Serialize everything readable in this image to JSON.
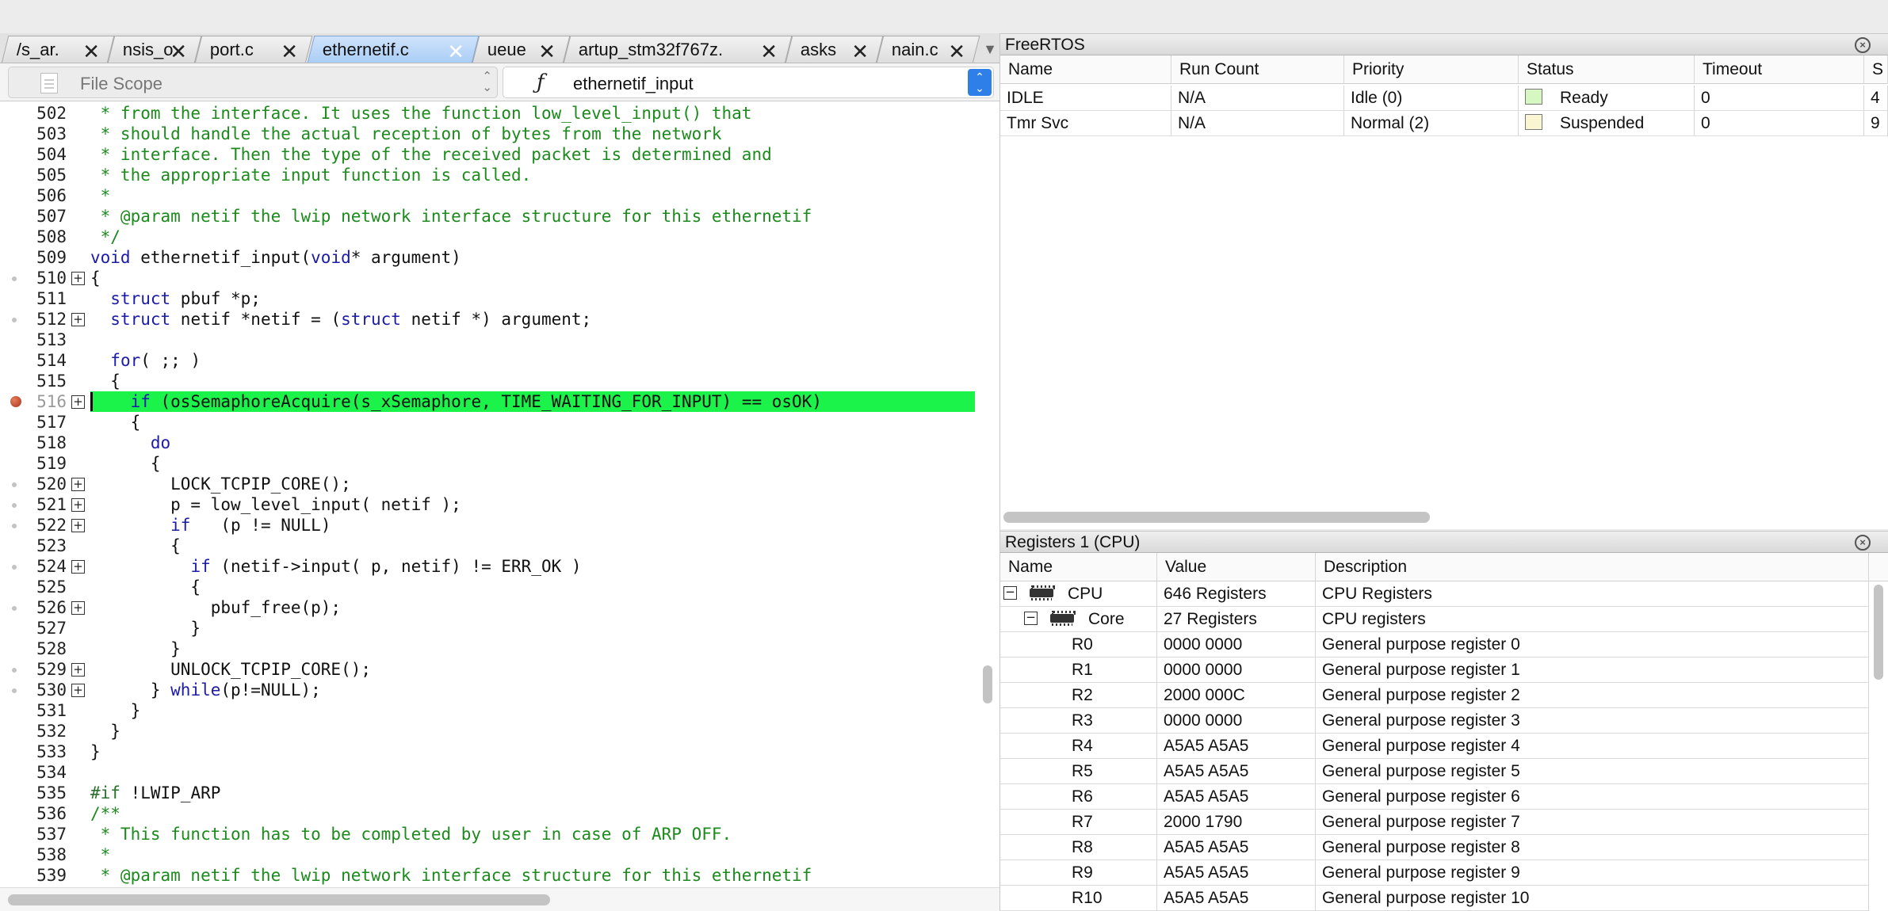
{
  "editor": {
    "tabs": [
      {
        "label": "/s_ar.",
        "active": false
      },
      {
        "label": "nsis_o.",
        "active": false
      },
      {
        "label": "port.c",
        "active": false
      },
      {
        "label": "ethernetif.c",
        "active": true
      },
      {
        "label": "ueue",
        "active": false
      },
      {
        "label": "artup_stm32f767z.",
        "active": false
      },
      {
        "label": "asks",
        "active": false
      },
      {
        "label": "nain.c",
        "active": false
      }
    ],
    "close_glyph": "✕",
    "scope_left": "File Scope",
    "scope_right_icon": "ƒ",
    "scope_right": "ethernetif_input",
    "lines": [
      {
        "n": "502",
        "bpdot": false,
        "fold": false,
        "parts": [
          {
            "t": "c",
            "s": " * from the interface. It uses the function low_level_input() that"
          }
        ]
      },
      {
        "n": "503",
        "bpdot": false,
        "fold": false,
        "parts": [
          {
            "t": "c",
            "s": " * should handle the actual reception of bytes from the network"
          }
        ]
      },
      {
        "n": "504",
        "bpdot": false,
        "fold": false,
        "parts": [
          {
            "t": "c",
            "s": " * interface. Then the type of the received packet is determined and"
          }
        ]
      },
      {
        "n": "505",
        "bpdot": false,
        "fold": false,
        "parts": [
          {
            "t": "c",
            "s": " * the appropriate input function is called."
          }
        ]
      },
      {
        "n": "506",
        "bpdot": false,
        "fold": false,
        "parts": [
          {
            "t": "c",
            "s": " *"
          }
        ]
      },
      {
        "n": "507",
        "bpdot": false,
        "fold": false,
        "parts": [
          {
            "t": "c",
            "s": " * @param netif the lwip network interface structure for this ethernetif"
          }
        ]
      },
      {
        "n": "508",
        "bpdot": false,
        "fold": false,
        "parts": [
          {
            "t": "c",
            "s": " */"
          }
        ]
      },
      {
        "n": "509",
        "bpdot": false,
        "fold": false,
        "parts": [
          {
            "t": "k",
            "s": "void"
          },
          {
            "t": "x",
            "s": " ethernetif_input("
          },
          {
            "t": "k",
            "s": "void"
          },
          {
            "t": "x",
            "s": "* argument)"
          }
        ]
      },
      {
        "n": "510",
        "bpdot": true,
        "fold": true,
        "parts": [
          {
            "t": "x",
            "s": "{"
          }
        ]
      },
      {
        "n": "511",
        "bpdot": false,
        "fold": false,
        "parts": [
          {
            "t": "x",
            "s": "  "
          },
          {
            "t": "k",
            "s": "struct"
          },
          {
            "t": "x",
            "s": " pbuf *p;"
          }
        ]
      },
      {
        "n": "512",
        "bpdot": true,
        "fold": true,
        "parts": [
          {
            "t": "x",
            "s": "  "
          },
          {
            "t": "k",
            "s": "struct"
          },
          {
            "t": "x",
            "s": " netif *netif = ("
          },
          {
            "t": "k",
            "s": "struct"
          },
          {
            "t": "x",
            "s": " netif *) argument;"
          }
        ]
      },
      {
        "n": "513",
        "bpdot": false,
        "fold": false,
        "parts": [
          {
            "t": "x",
            "s": ""
          }
        ]
      },
      {
        "n": "514",
        "bpdot": false,
        "fold": false,
        "parts": [
          {
            "t": "x",
            "s": "  "
          },
          {
            "t": "k",
            "s": "for"
          },
          {
            "t": "x",
            "s": "( ;; )"
          }
        ]
      },
      {
        "n": "515",
        "bpdot": false,
        "fold": false,
        "parts": [
          {
            "t": "x",
            "s": "  {"
          }
        ]
      },
      {
        "n": "516",
        "bpdot": false,
        "bp": true,
        "fold": true,
        "hl": true,
        "parts": [
          {
            "t": "x",
            "s": "    "
          },
          {
            "t": "k",
            "s": "if"
          },
          {
            "t": "x",
            "s": " (osSemaphoreAcquire(s_xSemaphore, TIME_WAITING_FOR_INPUT) == osOK)"
          }
        ]
      },
      {
        "n": "517",
        "bpdot": false,
        "fold": false,
        "parts": [
          {
            "t": "x",
            "s": "    {"
          }
        ]
      },
      {
        "n": "518",
        "bpdot": false,
        "fold": false,
        "parts": [
          {
            "t": "x",
            "s": "      "
          },
          {
            "t": "k",
            "s": "do"
          }
        ]
      },
      {
        "n": "519",
        "bpdot": false,
        "fold": false,
        "parts": [
          {
            "t": "x",
            "s": "      {"
          }
        ]
      },
      {
        "n": "520",
        "bpdot": true,
        "fold": true,
        "parts": [
          {
            "t": "x",
            "s": "        LOCK_TCPIP_CORE();"
          }
        ]
      },
      {
        "n": "521",
        "bpdot": true,
        "fold": true,
        "parts": [
          {
            "t": "x",
            "s": "        p = low_level_input( netif );"
          }
        ]
      },
      {
        "n": "522",
        "bpdot": true,
        "fold": true,
        "parts": [
          {
            "t": "x",
            "s": "        "
          },
          {
            "t": "k",
            "s": "if"
          },
          {
            "t": "x",
            "s": "   (p != NULL)"
          }
        ]
      },
      {
        "n": "523",
        "bpdot": false,
        "fold": false,
        "parts": [
          {
            "t": "x",
            "s": "        {"
          }
        ]
      },
      {
        "n": "524",
        "bpdot": true,
        "fold": true,
        "parts": [
          {
            "t": "x",
            "s": "          "
          },
          {
            "t": "k",
            "s": "if"
          },
          {
            "t": "x",
            "s": " (netif->input( p, netif) != ERR_OK )"
          }
        ]
      },
      {
        "n": "525",
        "bpdot": false,
        "fold": false,
        "parts": [
          {
            "t": "x",
            "s": "          {"
          }
        ]
      },
      {
        "n": "526",
        "bpdot": true,
        "fold": true,
        "parts": [
          {
            "t": "x",
            "s": "            pbuf_free(p);"
          }
        ]
      },
      {
        "n": "527",
        "bpdot": false,
        "fold": false,
        "parts": [
          {
            "t": "x",
            "s": "          }"
          }
        ]
      },
      {
        "n": "528",
        "bpdot": false,
        "fold": false,
        "parts": [
          {
            "t": "x",
            "s": "        }"
          }
        ]
      },
      {
        "n": "529",
        "bpdot": true,
        "fold": true,
        "parts": [
          {
            "t": "x",
            "s": "        UNLOCK_TCPIP_CORE();"
          }
        ]
      },
      {
        "n": "530",
        "bpdot": true,
        "fold": true,
        "parts": [
          {
            "t": "x",
            "s": "      } "
          },
          {
            "t": "k",
            "s": "while"
          },
          {
            "t": "x",
            "s": "(p!=NULL);"
          }
        ]
      },
      {
        "n": "531",
        "bpdot": false,
        "fold": false,
        "parts": [
          {
            "t": "x",
            "s": "    }"
          }
        ]
      },
      {
        "n": "532",
        "bpdot": false,
        "fold": false,
        "parts": [
          {
            "t": "x",
            "s": "  }"
          }
        ]
      },
      {
        "n": "533",
        "bpdot": false,
        "fold": false,
        "parts": [
          {
            "t": "x",
            "s": "}"
          }
        ]
      },
      {
        "n": "534",
        "bpdot": false,
        "fold": false,
        "parts": [
          {
            "t": "x",
            "s": ""
          }
        ]
      },
      {
        "n": "535",
        "bpdot": false,
        "fold": false,
        "parts": [
          {
            "t": "p",
            "s": "#if"
          },
          {
            "t": "x",
            "s": " !LWIP_ARP"
          }
        ]
      },
      {
        "n": "536",
        "bpdot": false,
        "fold": false,
        "parts": [
          {
            "t": "c",
            "s": "/**"
          }
        ]
      },
      {
        "n": "537",
        "bpdot": false,
        "fold": false,
        "parts": [
          {
            "t": "c",
            "s": " * This function has to be completed by user in case of ARP OFF."
          }
        ]
      },
      {
        "n": "538",
        "bpdot": false,
        "fold": false,
        "parts": [
          {
            "t": "c",
            "s": " *"
          }
        ]
      },
      {
        "n": "539",
        "bpdot": false,
        "fold": false,
        "parts": [
          {
            "t": "c",
            "s": " * @param netif the lwip network interface structure for this ethernetif"
          }
        ]
      }
    ]
  },
  "freertos": {
    "title": "FreeRTOS",
    "close": "×",
    "columns": [
      "Name",
      "Run Count",
      "Priority",
      "Status",
      "Timeout",
      "S"
    ],
    "rows": [
      {
        "name": "IDLE",
        "run_count": "N/A",
        "priority": "Idle (0)",
        "status": "Ready",
        "status_color": "#d7f7c2",
        "timeout": "0",
        "extra": "4"
      },
      {
        "name": "Tmr Svc",
        "run_count": "N/A",
        "priority": "Normal (2)",
        "status": "Suspended",
        "status_color": "#fbf6d2",
        "timeout": "0",
        "extra": "9"
      }
    ]
  },
  "registers": {
    "title": "Registers 1 (CPU)",
    "close": "×",
    "columns": [
      "Name",
      "Value",
      "Description"
    ],
    "groups": [
      {
        "name": "CPU",
        "value": "646 Registers",
        "desc": "CPU Registers",
        "level": 0
      },
      {
        "name": "Core",
        "value": "27 Registers",
        "desc": "CPU registers",
        "level": 1
      }
    ],
    "rows": [
      {
        "name": "R0",
        "value": "0000 0000",
        "desc": "General purpose register 0"
      },
      {
        "name": "R1",
        "value": "0000 0000",
        "desc": "General purpose register 1"
      },
      {
        "name": "R2",
        "value": "2000 000C",
        "desc": "General purpose register 2"
      },
      {
        "name": "R3",
        "value": "0000 0000",
        "desc": "General purpose register 3"
      },
      {
        "name": "R4",
        "value": "A5A5 A5A5",
        "desc": "General purpose register 4"
      },
      {
        "name": "R5",
        "value": "A5A5 A5A5",
        "desc": "General purpose register 5"
      },
      {
        "name": "R6",
        "value": "A5A5 A5A5",
        "desc": "General purpose register 6"
      },
      {
        "name": "R7",
        "value": "2000 1790",
        "desc": "General purpose register 7"
      },
      {
        "name": "R8",
        "value": "A5A5 A5A5",
        "desc": "General purpose register 8"
      },
      {
        "name": "R9",
        "value": "A5A5 A5A5",
        "desc": "General purpose register 9"
      },
      {
        "name": "R10",
        "value": "A5A5 A5A5",
        "desc": "General purpose register 10"
      }
    ]
  },
  "colors": {
    "highlight": "#1bf24a",
    "comment": "#1c8a1c",
    "keyword": "#1b1ba8",
    "active_tab": "#a9cdf6"
  }
}
